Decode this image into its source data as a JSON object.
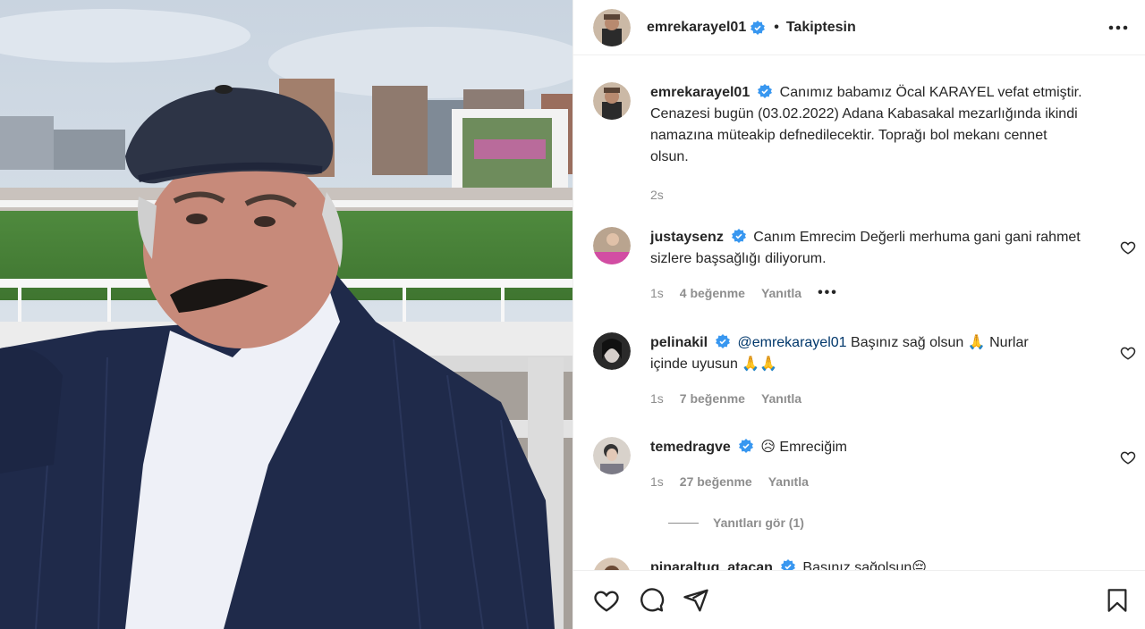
{
  "post": {
    "username": "emrekarayel01",
    "follow_label": "Takiptesin",
    "separator": "•",
    "caption": "Canımız babamız Öcal KARAYEL vefat etmiştir. Cenazesi bugün (03.02.2022) Adana Kabasakal mezarlığında ikindi namazına müteakip defnedilecektir. Toprağı bol mekanı cennet olsun.",
    "time": "2s"
  },
  "comments": [
    {
      "username": "justaysenz",
      "text": "Canım Emrecim Değerli merhuma gani gani rahmet sizlere başsağlığı diliyorum.",
      "time": "1s",
      "likes": "4 beğenme",
      "reply": "Yanıtla",
      "more": "•••"
    },
    {
      "username": "pelinakil",
      "mention": "@emrekarayel01",
      "text_a": "Başınız sağ olsun 🙏 Nurlar",
      "text_b": "içinde uyusun 🙏🙏",
      "time": "1s",
      "likes": "7 beğenme",
      "reply": "Yanıtla"
    },
    {
      "username": "temedragve",
      "text": "😥 Emreciğim",
      "time": "1s",
      "likes": "27 beğenme",
      "reply": "Yanıtla"
    },
    {
      "username": "pinaraltug_atacan",
      "text": "Başınız sağolsun😔"
    }
  ],
  "view_replies": "Yanıtları gör (1)",
  "colors": {
    "verified": "#3897f0",
    "text": "#262626",
    "muted": "#8e8e8e",
    "mention": "#00376b"
  },
  "icons": [
    "more-options-icon",
    "heart-icon",
    "comment-icon",
    "share-icon",
    "bookmark-icon",
    "verified-badge-icon"
  ]
}
